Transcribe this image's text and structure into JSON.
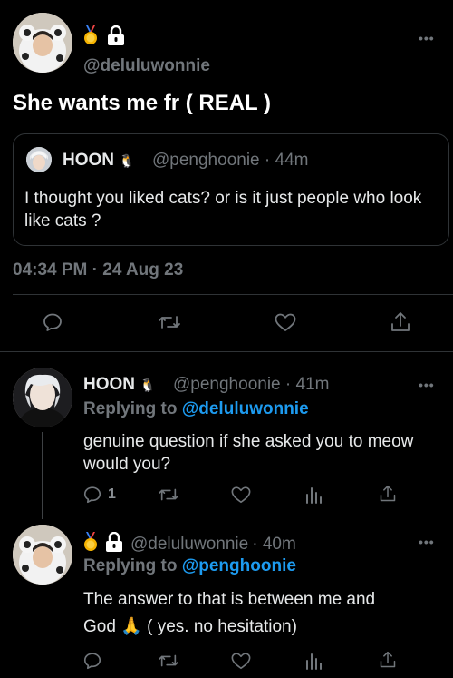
{
  "main_tweet": {
    "badges": [
      "medal-icon",
      "lock-icon"
    ],
    "handle": "@deluluwonnie",
    "text": "She wants me fr ( REAL )",
    "quote": {
      "name": "HOON",
      "emoji": "🐧",
      "handle": "@penghoonie",
      "time": "· 44m",
      "text": "I thought you liked cats? or is it just people who look like cats ?"
    },
    "timestamp": "04:34 PM · 24 Aug 23",
    "actions": [
      "reply-icon",
      "retweet-icon",
      "like-icon",
      "share-icon"
    ]
  },
  "replies": [
    {
      "name": "HOON",
      "emoji": "🐧",
      "handle": "@penghoonie",
      "time": "· 41m",
      "replying_prefix": "Replying to",
      "replying_to": "@deluluwonnie",
      "text": "genuine question if she asked you to meow would you?",
      "reply_count": "1"
    },
    {
      "badges": [
        "medal-icon",
        "lock-icon"
      ],
      "handle": "@deluluwonnie",
      "time": "· 40m",
      "replying_prefix": "Replying to",
      "replying_to": "@penghoonie",
      "text_line1": "The answer to that is between me and",
      "text_line2": "God 🙏  ( yes. no hesitation)"
    }
  ],
  "more_label": "•••",
  "colors": {
    "background": "#000000",
    "text": "#e7e9ea",
    "muted": "#71767b",
    "accent": "#1d9bf0",
    "border": "#2f3336"
  }
}
